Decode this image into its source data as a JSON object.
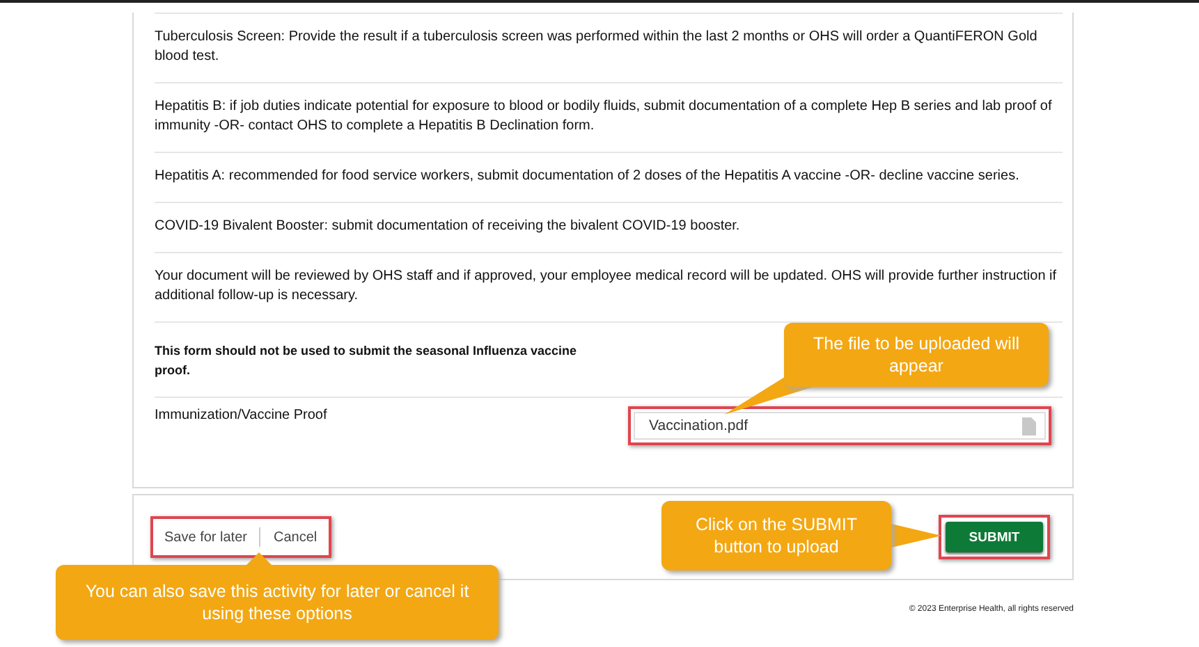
{
  "instructions": [
    "Tuberculosis Screen: Provide the result if a tuberculosis screen was performed within the last 2 months or OHS will order a QuantiFERON Gold blood test.",
    "Hepatitis B: if job duties indicate potential for exposure to blood or bodily fluids, submit documentation of a complete Hep B series and lab proof of immunity -OR- contact OHS to complete a Hepatitis B Declination form.",
    "Hepatitis A: recommended for food service workers, submit documentation of 2 doses of the Hepatitis A vaccine -OR- decline vaccine series.",
    "COVID-19 Bivalent Booster: submit documentation of receiving the bivalent COVID-19 booster.",
    "Your document will be reviewed by OHS staff and if approved, your employee medical record will be updated. OHS will provide further instruction if additional follow-up is necessary."
  ],
  "notice": "This form should not be used to submit the seasonal Influenza vaccine proof.",
  "upload_field": {
    "label": "Immunization/Vaccine Proof",
    "value": "Vaccination.pdf"
  },
  "footer": {
    "links": [
      "Save for later",
      "Cancel"
    ],
    "submit": "SUBMIT"
  },
  "callouts": [
    {
      "kind": "file",
      "text": "The file to be uploaded will appear"
    },
    {
      "kind": "submit",
      "text": "Click on the SUBMIT button to upload"
    },
    {
      "kind": "save",
      "text": "You can also save this activity for later or cancel it using these options"
    }
  ],
  "copyright": "© 2023 Enterprise Health, all rights reserved"
}
